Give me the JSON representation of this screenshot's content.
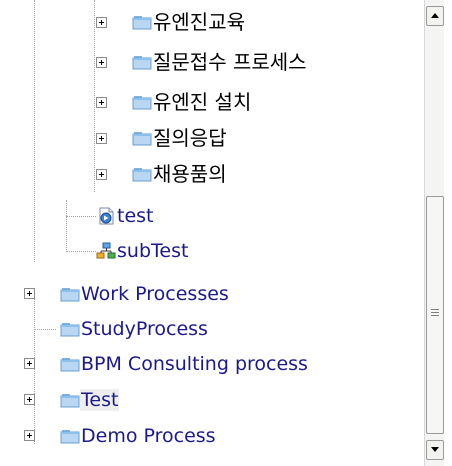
{
  "tree": {
    "nested_items": [
      {
        "label": "유엔진교육",
        "icon": "folder-icon",
        "expandable": true
      },
      {
        "label": "질문접수 프로세스",
        "icon": "folder-icon",
        "expandable": true
      },
      {
        "label": "유엔진 설치",
        "icon": "folder-icon",
        "expandable": true
      },
      {
        "label": "질의응답",
        "icon": "folder-icon",
        "expandable": true
      },
      {
        "label": "채용품의",
        "icon": "folder-icon",
        "expandable": true
      },
      {
        "label": "test",
        "icon": "process-definition-icon",
        "expandable": false
      },
      {
        "label": "subTest",
        "icon": "subprocess-icon",
        "expandable": false
      }
    ],
    "root_items": [
      {
        "label": "Work Processes",
        "icon": "folder-icon",
        "expandable": true
      },
      {
        "label": "StudyProcess",
        "icon": "folder-icon",
        "expandable": false
      },
      {
        "label": "BPM Consulting process",
        "icon": "folder-icon",
        "expandable": true
      },
      {
        "label": "Test",
        "icon": "folder-icon",
        "expandable": true,
        "selected": true
      },
      {
        "label": "Demo Process",
        "icon": "folder-icon",
        "expandable": true
      }
    ]
  },
  "scrollbar": {
    "up_icon": "arrow-up-icon",
    "down_icon": "arrow-down-icon",
    "position": 0.45
  },
  "colors": {
    "folder_top": "#7fb5e6",
    "folder_body": "#b9d6f2",
    "link_text": "#1a1a8c",
    "connector": "#a0a0a0"
  }
}
